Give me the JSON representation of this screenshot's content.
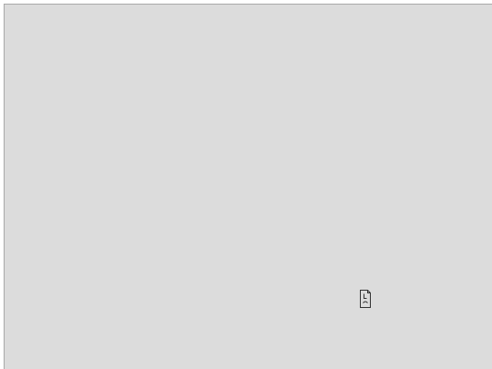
{
  "page": {
    "background_color": "#dcdcdc",
    "border_color": "#a9a9a9"
  },
  "content": {
    "icon": "broken-image-icon",
    "icon_color": "#333333"
  }
}
